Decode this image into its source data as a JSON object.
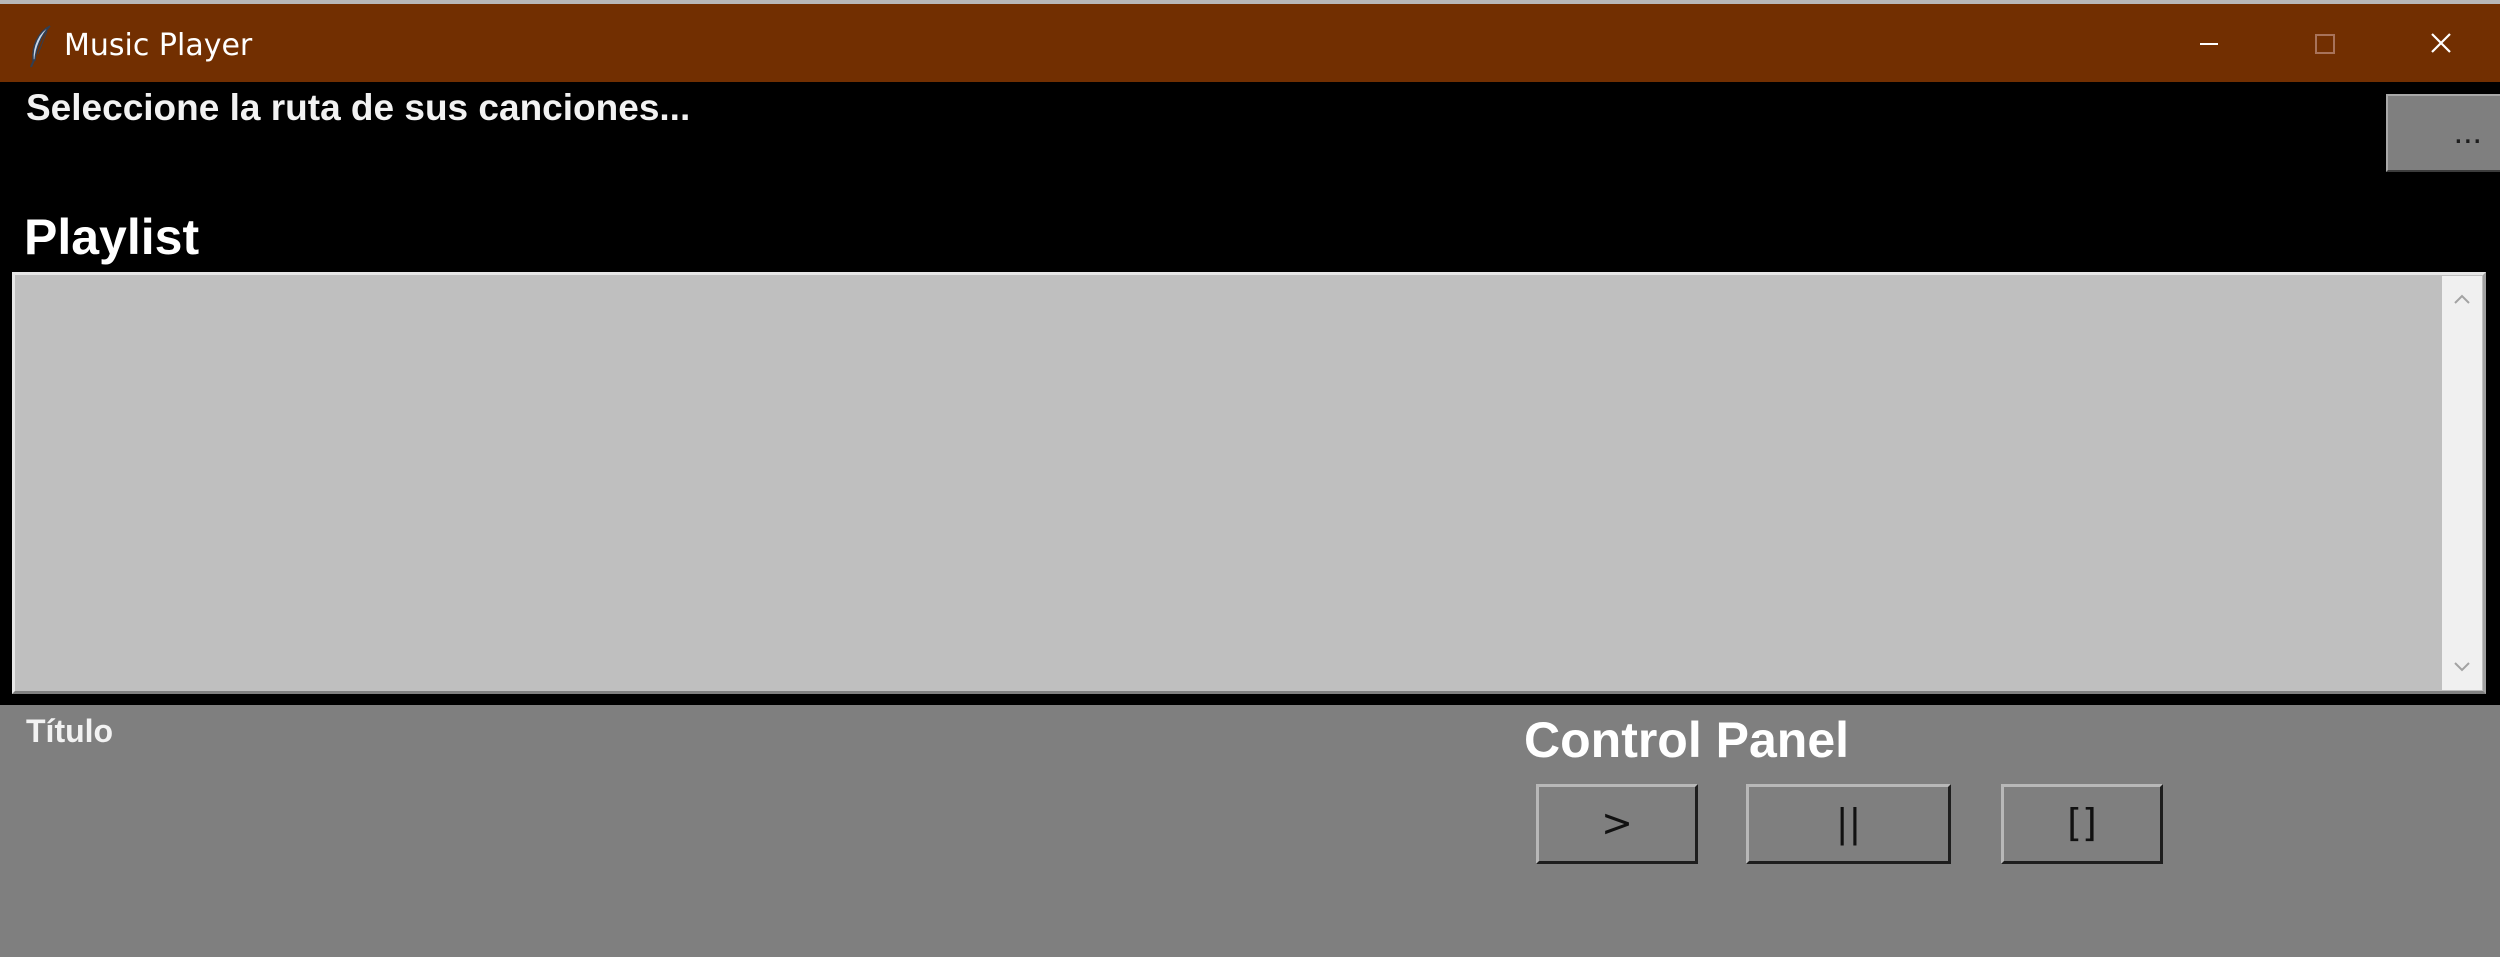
{
  "window": {
    "title": "Music Player",
    "title_bar_color": "#722f01",
    "icon": "feather-icon"
  },
  "window_controls": {
    "minimize_icon": "minimize-icon",
    "maximize_icon": "maximize-icon",
    "close_icon": "close-icon"
  },
  "path_section": {
    "label": "Seleccione la ruta de sus canciones...",
    "browse_button_label": "..."
  },
  "playlist": {
    "heading": "Playlist",
    "items": [],
    "background_color": "#bfbfbf"
  },
  "now_playing": {
    "title_label": "Título"
  },
  "control_panel": {
    "heading": "Control Panel",
    "play_label": ">",
    "pause_label": "||",
    "stop_label": "[]"
  }
}
